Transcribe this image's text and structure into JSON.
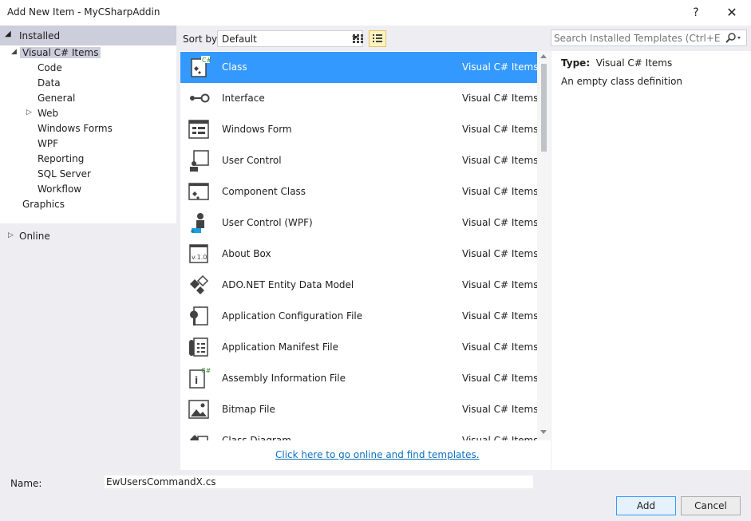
{
  "window": {
    "title": "Add New Item - MyCSharpAddin",
    "help_glyph": "?",
    "close_glyph": "✕"
  },
  "left_panel": {
    "installed_label": "Installed",
    "tree": [
      {
        "label": "Visual C# Items",
        "level": 1,
        "expander": "◢",
        "selected": true
      },
      {
        "label": "Code",
        "level": 2
      },
      {
        "label": "Data",
        "level": 2
      },
      {
        "label": "General",
        "level": 2
      },
      {
        "label": "Web",
        "level": 2,
        "expander": "▷"
      },
      {
        "label": "Windows Forms",
        "level": 2
      },
      {
        "label": "WPF",
        "level": 2
      },
      {
        "label": "Reporting",
        "level": 2
      },
      {
        "label": "SQL Server",
        "level": 2
      },
      {
        "label": "Workflow",
        "level": 2
      },
      {
        "label": "Graphics",
        "level": 1
      }
    ],
    "online_label": "Online"
  },
  "toolbar": {
    "sort_label": "Sort by:",
    "sort_value": "Default"
  },
  "search": {
    "placeholder": "Search Installed Templates (Ctrl+E)"
  },
  "templates": [
    {
      "name": "Class",
      "category": "Visual C# Items",
      "icon": "class-icon",
      "selected": true
    },
    {
      "name": "Interface",
      "category": "Visual C# Items",
      "icon": "interface-icon"
    },
    {
      "name": "Windows Form",
      "category": "Visual C# Items",
      "icon": "windows-form-icon"
    },
    {
      "name": "User Control",
      "category": "Visual C# Items",
      "icon": "user-control-icon"
    },
    {
      "name": "Component Class",
      "category": "Visual C# Items",
      "icon": "component-class-icon"
    },
    {
      "name": "User Control (WPF)",
      "category": "Visual C# Items",
      "icon": "user-control-wpf-icon"
    },
    {
      "name": "About Box",
      "category": "Visual C# Items",
      "icon": "about-box-icon"
    },
    {
      "name": "ADO.NET Entity Data Model",
      "category": "Visual C# Items",
      "icon": "entity-data-model-icon"
    },
    {
      "name": "Application Configuration File",
      "category": "Visual C# Items",
      "icon": "config-file-icon"
    },
    {
      "name": "Application Manifest File",
      "category": "Visual C# Items",
      "icon": "manifest-file-icon"
    },
    {
      "name": "Assembly Information File",
      "category": "Visual C# Items",
      "icon": "assembly-info-icon"
    },
    {
      "name": "Bitmap File",
      "category": "Visual C# Items",
      "icon": "bitmap-icon"
    },
    {
      "name": "Class Diagram",
      "category": "Visual C# Items",
      "icon": "class-diagram-icon"
    }
  ],
  "online_link": "Click here to go online and find templates.",
  "details": {
    "type_label": "Type:",
    "type_value": "Visual C# Items",
    "description": "An empty class definition"
  },
  "bottom": {
    "name_label": "Name:",
    "name_value": "EwUsersCommandX.cs",
    "add_label": "Add",
    "cancel_label": "Cancel"
  },
  "colors": {
    "selection": "#3399ff",
    "link": "#0e70c0",
    "panel": "#eeeef2",
    "installed_header": "#cccedb"
  }
}
